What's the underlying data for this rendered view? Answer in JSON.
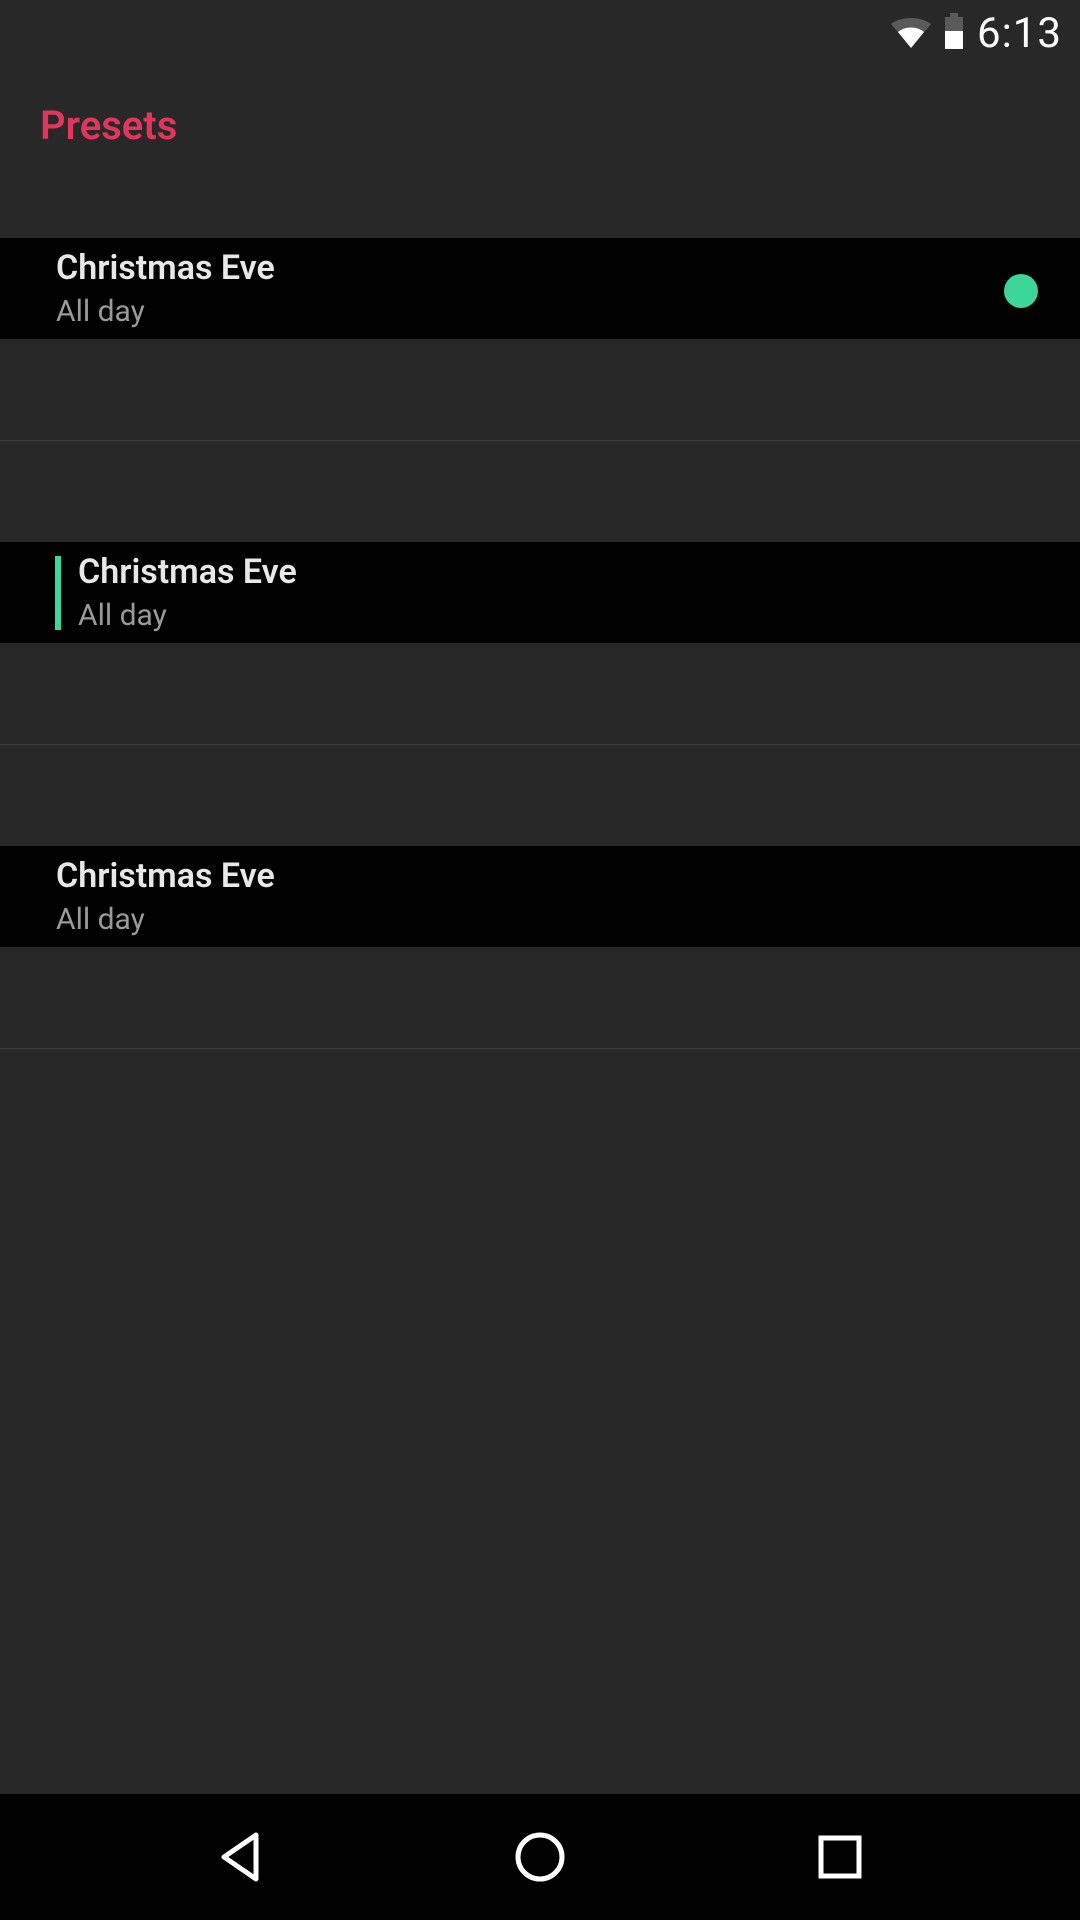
{
  "status": {
    "time": "6:13"
  },
  "header": {
    "title": "Presets"
  },
  "presets": [
    {
      "title": "Christmas Eve",
      "subtitle": "All day",
      "has_dot": true,
      "has_bar": false
    },
    {
      "title": "Christmas Eve",
      "subtitle": "All day",
      "has_dot": false,
      "has_bar": true
    },
    {
      "title": "Christmas Eve",
      "subtitle": "All day",
      "has_dot": false,
      "has_bar": false
    }
  ],
  "colors": {
    "accent": "#e2355e",
    "indicator": "#3cd699",
    "bg": "#282828",
    "card": "#000000"
  }
}
